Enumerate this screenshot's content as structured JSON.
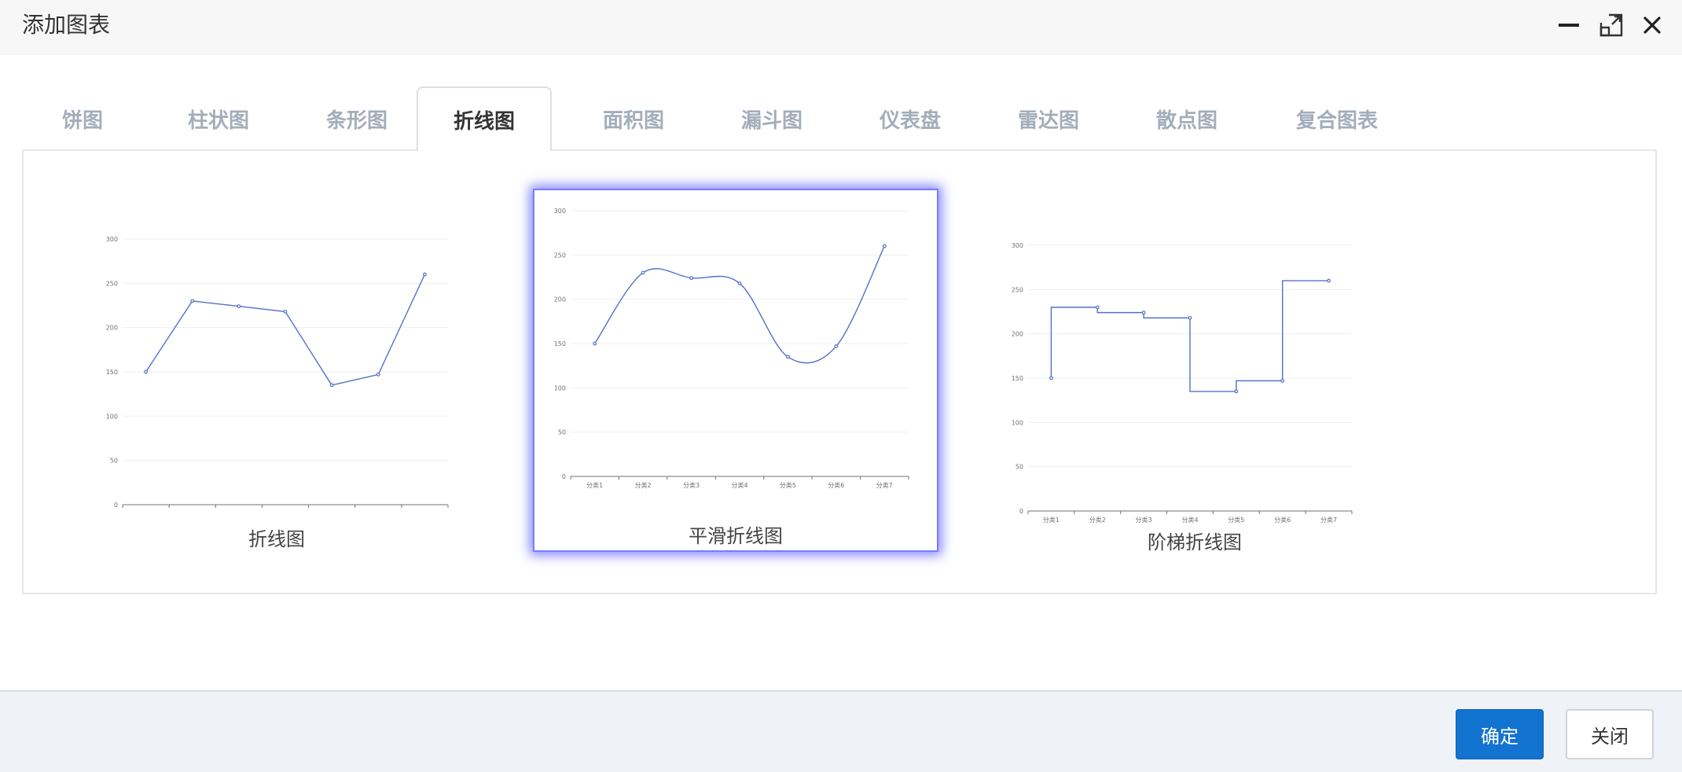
{
  "dialog": {
    "title": "添加图表",
    "controls": {
      "minimize_icon": "minimize-icon",
      "maximize_icon": "maximize-icon",
      "close_icon": "close-icon"
    }
  },
  "tabs": [
    {
      "label": "饼图",
      "active": false
    },
    {
      "label": "柱状图",
      "active": false
    },
    {
      "label": "条形图",
      "active": false
    },
    {
      "label": "折线图",
      "active": true
    },
    {
      "label": "面积图",
      "active": false
    },
    {
      "label": "漏斗图",
      "active": false
    },
    {
      "label": "仪表盘",
      "active": false
    },
    {
      "label": "雷达图",
      "active": false
    },
    {
      "label": "散点图",
      "active": false
    },
    {
      "label": "复合图表",
      "active": false
    }
  ],
  "chart_types": [
    {
      "label": "折线图",
      "selected": false,
      "style": "straight"
    },
    {
      "label": "平滑折线图",
      "selected": true,
      "style": "smooth"
    },
    {
      "label": "阶梯折线图",
      "selected": false,
      "style": "step"
    }
  ],
  "chart_data": {
    "type": "line",
    "categories": [
      "分类1",
      "分类2",
      "分类3",
      "分类4",
      "分类5",
      "分类6",
      "分类7"
    ],
    "values": [
      150,
      230,
      224,
      218,
      135,
      147,
      260
    ],
    "yticks": [
      0,
      50,
      100,
      150,
      200,
      250,
      300
    ],
    "ylim": [
      0,
      300
    ],
    "grid": true,
    "line_color": "#5470c6"
  },
  "footer": {
    "confirm_label": "确定",
    "close_label": "关闭"
  },
  "colors": {
    "primary": "#1273d0",
    "selection_glow": "#6a6aff",
    "tab_inactive": "#a3adbb"
  }
}
